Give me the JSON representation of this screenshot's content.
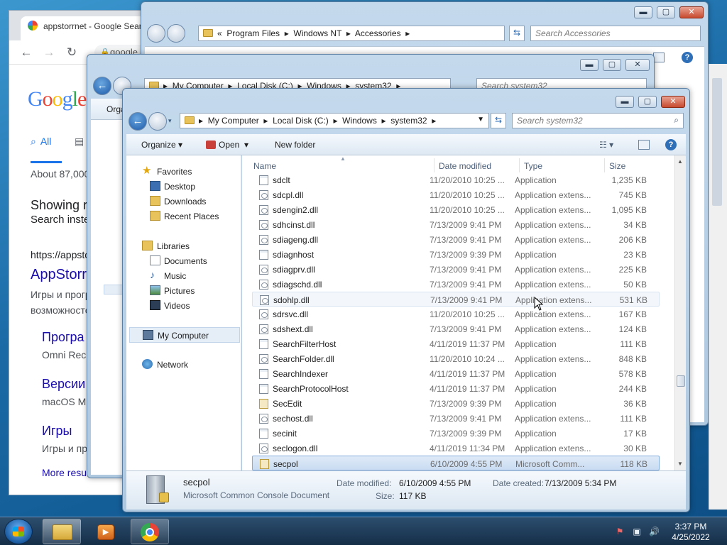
{
  "chrome": {
    "tab_title": "appstorrnet - Google Search",
    "url": "google.",
    "logo": "Google",
    "tab_all": "All",
    "about": "About 87,000",
    "showing": "Showing r",
    "search_instead": "Search inste",
    "result_url": "https://appsto",
    "result_title": "AppStorr",
    "result_snippet_1": "Игры и програ",
    "result_snippet_2": "возможносте",
    "sub1_title": "Програ",
    "sub1_snippet": "Omni Rec",
    "sub2_title": "Версии",
    "sub2_snippet": "macOS M",
    "sub3_title": "Игры",
    "sub3_snippet": "Игры и пр",
    "more_results": "More resu"
  },
  "win_accessories": {
    "breadcrumb": [
      "Program Files",
      "Windows NT",
      "Accessories"
    ],
    "search_placeholder": "Search Accessories"
  },
  "win_system32_back": {
    "breadcrumb": [
      "My Computer",
      "Local Disk (C:)",
      "Windows",
      "system32"
    ],
    "search_placeholder": "Search system32",
    "toolbar_partial": "Orga"
  },
  "explorer": {
    "breadcrumb": [
      "My Computer",
      "Local Disk (C:)",
      "Windows",
      "system32"
    ],
    "search_placeholder": "Search system32",
    "toolbar": {
      "organize": "Organize",
      "open": "Open",
      "new_folder": "New folder"
    },
    "nav": {
      "favorites": "Favorites",
      "desktop": "Desktop",
      "downloads": "Downloads",
      "recent": "Recent Places",
      "libraries": "Libraries",
      "documents": "Documents",
      "music": "Music",
      "pictures": "Pictures",
      "videos": "Videos",
      "computer": "My Computer",
      "network": "Network"
    },
    "columns": {
      "name": "Name",
      "date": "Date modified",
      "type": "Type",
      "size": "Size"
    },
    "files": [
      {
        "name": "sdclt",
        "date": "11/20/2010 10:25 ...",
        "type": "Application",
        "size": "1,235 KB",
        "icon": "app"
      },
      {
        "name": "sdcpl.dll",
        "date": "11/20/2010 10:25 ...",
        "type": "Application extens...",
        "size": "745 KB",
        "icon": "dll"
      },
      {
        "name": "sdengin2.dll",
        "date": "11/20/2010 10:25 ...",
        "type": "Application extens...",
        "size": "1,095 KB",
        "icon": "dll"
      },
      {
        "name": "sdhcinst.dll",
        "date": "7/13/2009 9:41 PM",
        "type": "Application extens...",
        "size": "34 KB",
        "icon": "dll"
      },
      {
        "name": "sdiageng.dll",
        "date": "7/13/2009 9:41 PM",
        "type": "Application extens...",
        "size": "206 KB",
        "icon": "dll"
      },
      {
        "name": "sdiagnhost",
        "date": "7/13/2009 9:39 PM",
        "type": "Application",
        "size": "23 KB",
        "icon": "app"
      },
      {
        "name": "sdiagprv.dll",
        "date": "7/13/2009 9:41 PM",
        "type": "Application extens...",
        "size": "225 KB",
        "icon": "dll"
      },
      {
        "name": "sdiagschd.dll",
        "date": "7/13/2009 9:41 PM",
        "type": "Application extens...",
        "size": "50 KB",
        "icon": "dll"
      },
      {
        "name": "sdohlp.dll",
        "date": "7/13/2009 9:41 PM",
        "type": "Application extens...",
        "size": "531 KB",
        "icon": "dll"
      },
      {
        "name": "sdrsvc.dll",
        "date": "11/20/2010 10:25 ...",
        "type": "Application extens...",
        "size": "167 KB",
        "icon": "dll"
      },
      {
        "name": "sdshext.dll",
        "date": "7/13/2009 9:41 PM",
        "type": "Application extens...",
        "size": "124 KB",
        "icon": "dll"
      },
      {
        "name": "SearchFilterHost",
        "date": "4/11/2019 11:37 PM",
        "type": "Application",
        "size": "111 KB",
        "icon": "app"
      },
      {
        "name": "SearchFolder.dll",
        "date": "11/20/2010 10:24 ...",
        "type": "Application extens...",
        "size": "848 KB",
        "icon": "dll"
      },
      {
        "name": "SearchIndexer",
        "date": "4/11/2019 11:37 PM",
        "type": "Application",
        "size": "578 KB",
        "icon": "app"
      },
      {
        "name": "SearchProtocolHost",
        "date": "4/11/2019 11:37 PM",
        "type": "Application",
        "size": "244 KB",
        "icon": "app"
      },
      {
        "name": "SecEdit",
        "date": "7/13/2009 9:39 PM",
        "type": "Application",
        "size": "36 KB",
        "icon": "lock"
      },
      {
        "name": "sechost.dll",
        "date": "7/13/2009 9:41 PM",
        "type": "Application extens...",
        "size": "111 KB",
        "icon": "dll"
      },
      {
        "name": "secinit",
        "date": "7/13/2009 9:39 PM",
        "type": "Application",
        "size": "17 KB",
        "icon": "app"
      },
      {
        "name": "seclogon.dll",
        "date": "4/11/2019 11:34 PM",
        "type": "Application extens...",
        "size": "30 KB",
        "icon": "dll"
      },
      {
        "name": "secpol",
        "date": "6/10/2009 4:55 PM",
        "type": "Microsoft Comm...",
        "size": "118 KB",
        "icon": "lock"
      }
    ],
    "hovered_index": 8,
    "selected_index": 19,
    "details": {
      "name": "secpol",
      "type": "Microsoft Common Console Document",
      "modified_label": "Date modified:",
      "modified_value": "6/10/2009 4:55 PM",
      "created_label": "Date created:",
      "created_value": "7/13/2009 5:34 PM",
      "size_label": "Size:",
      "size_value": "117 KB"
    }
  },
  "taskbar": {
    "time": "3:37 PM",
    "date": "4/25/2022"
  }
}
